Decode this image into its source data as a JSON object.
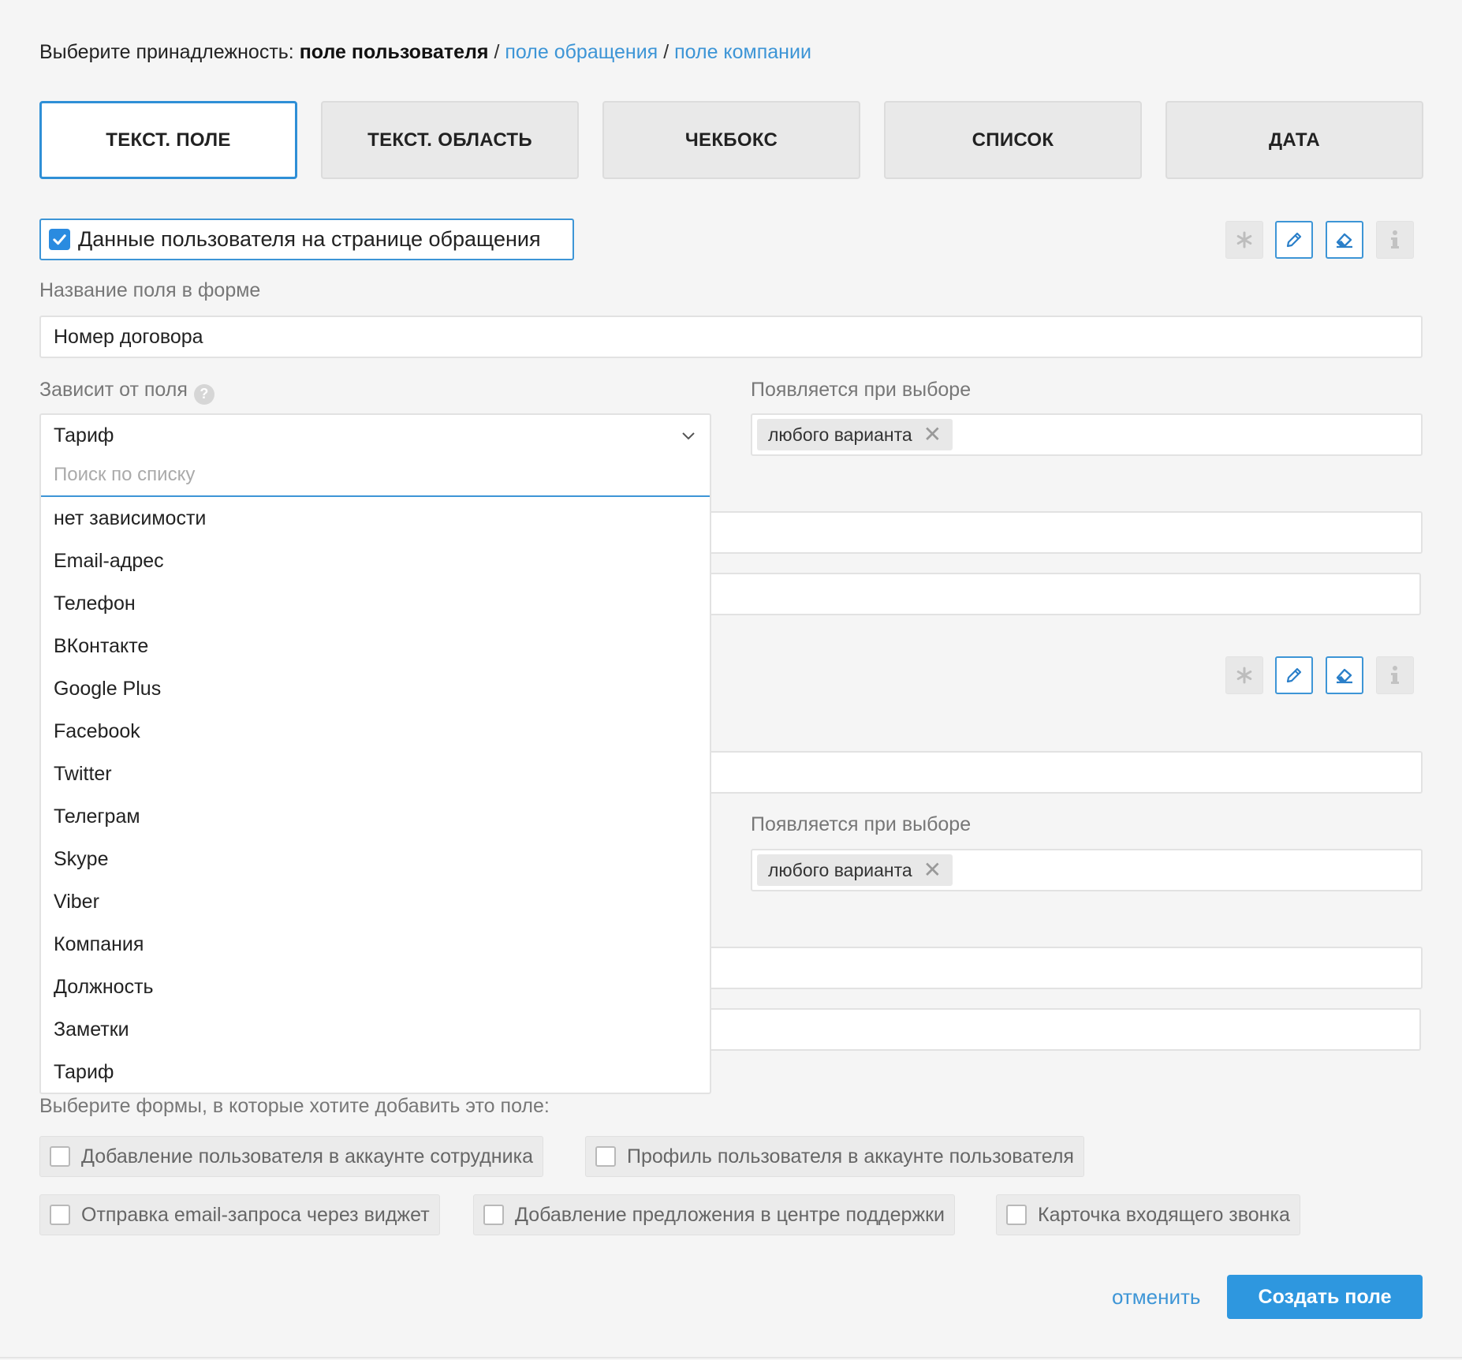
{
  "affiliation": {
    "prefix": "Выберите принадлежность:",
    "selected": "поле пользователя",
    "separator": "/",
    "option_ticket": "поле обращения",
    "option_company": "поле компании"
  },
  "field_types": [
    "ТЕКСТ. ПОЛЕ",
    "ТЕКСТ. ОБЛАСТЬ",
    "ЧЕКБОКС",
    "СПИСОК",
    "ДАТА"
  ],
  "active_field_type": "ТЕКСТ. ПОЛЕ",
  "user_data_checkbox": {
    "label": "Данные пользователя на странице обращения",
    "checked": true
  },
  "tool_icons": [
    "asterisk-icon",
    "pencil-icon",
    "eraser-icon",
    "info-icon"
  ],
  "field_name": {
    "label": "Название поля в форме",
    "value": "Номер договора"
  },
  "depends_on": {
    "label": "Зависит от поля",
    "help": "?",
    "selected": "Тариф",
    "search_placeholder": "Поиск по списку",
    "options": [
      "нет зависимости",
      "Email-адрес",
      "Телефон",
      "ВКонтакте",
      "Google Plus",
      "Facebook",
      "Twitter",
      "Телеграм",
      "Skype",
      "Viber",
      "Компания",
      "Должность",
      "Заметки",
      "Тариф"
    ]
  },
  "appears_on": {
    "label": "Появляется при выборе",
    "tag": "любого варианта",
    "remove": "✕"
  },
  "second_block": {
    "appears_label": "Появляется при выборе",
    "tag": "любого варианта",
    "remove": "✕"
  },
  "forms": {
    "label": "Выберите формы, в которые хотите добавить это поле:",
    "row1": [
      "Добавление пользователя в аккаунте сотрудника",
      "Профиль пользователя в аккаунте пользователя"
    ],
    "row2": [
      "Отправка email-запроса через виджет",
      "Добавление предложения в центре поддержки",
      "Карточка входящего звонка"
    ]
  },
  "actions": {
    "cancel": "отменить",
    "create": "Создать поле"
  },
  "colors": {
    "accent": "#2e97df",
    "link": "#3d95d6",
    "background": "#f5f5f5"
  }
}
